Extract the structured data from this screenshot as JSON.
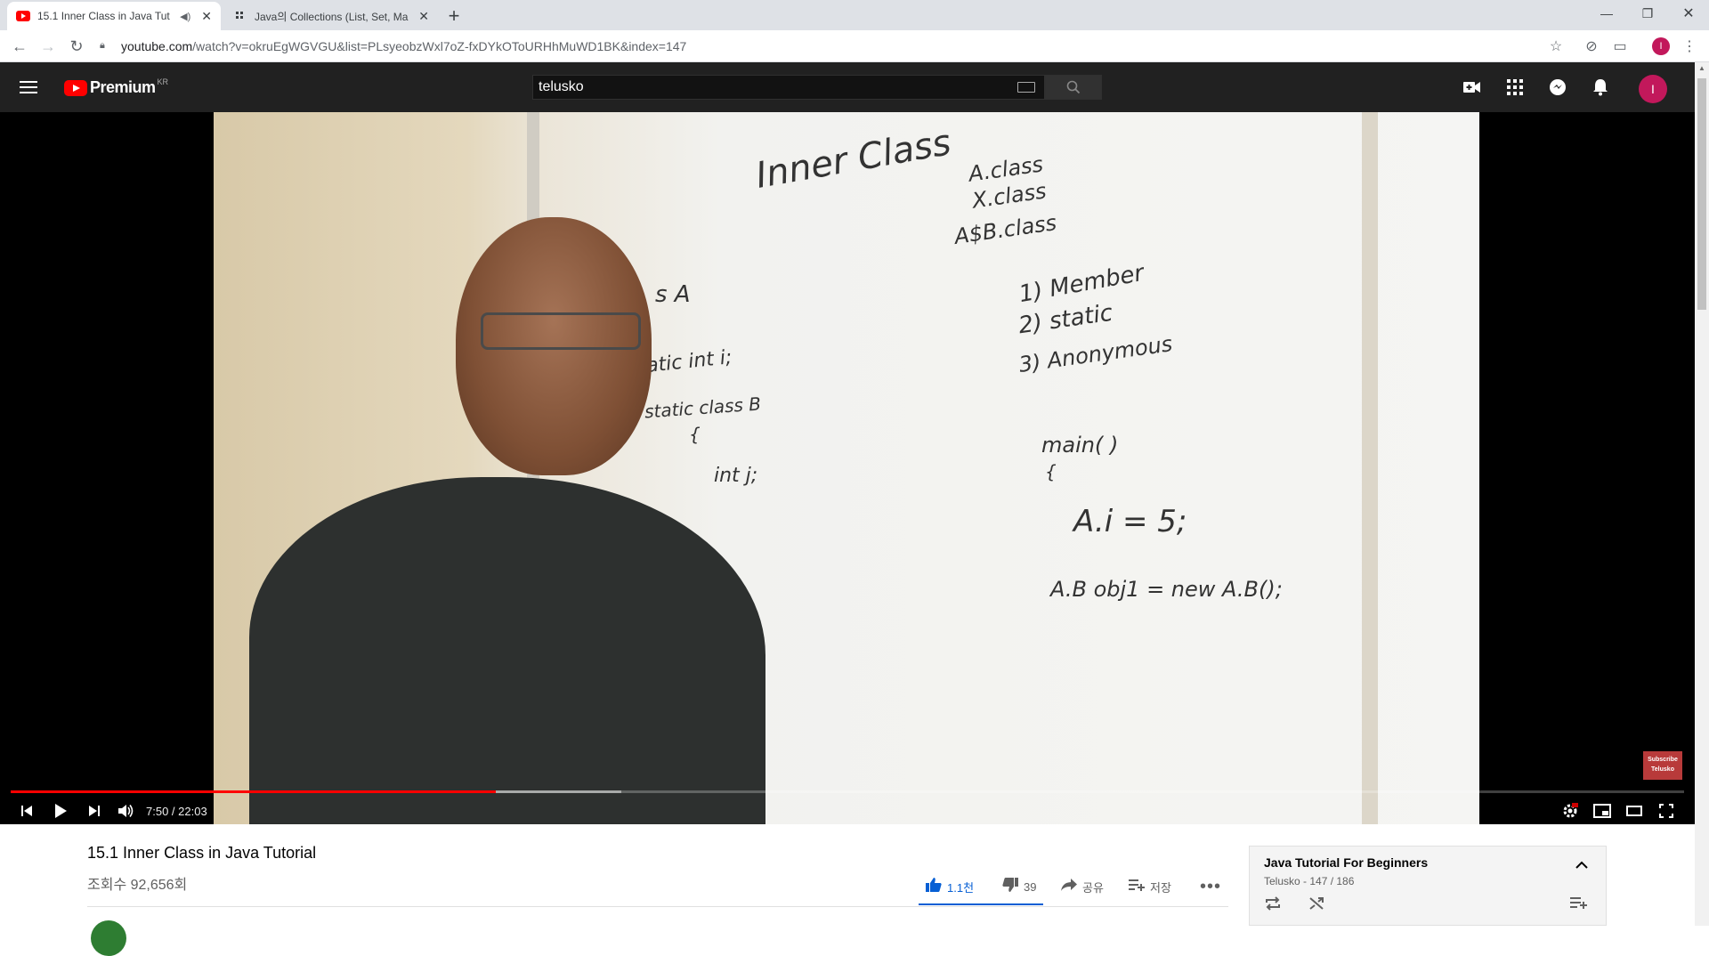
{
  "browser": {
    "tabs": [
      {
        "title": "15.1 Inner Class in Java Tut",
        "favicon": "youtube-icon",
        "active": true
      },
      {
        "title": "Java의 Collections (List, Set, Ma",
        "favicon": "velog-icon",
        "active": false
      }
    ],
    "url_host": "youtube.com",
    "url_rest": "/watch?v=okruEgWGVGU&list=PLsyeobzWxl7oZ-fxDYkOToURHhMuWD1BK&index=147",
    "profile_initial": "I"
  },
  "masthead": {
    "logo_text": "Premium",
    "region": "KR",
    "search_value": "telusko",
    "avatar_initial": "I"
  },
  "whiteboard": {
    "title": "Inner Class",
    "line1": "A.class",
    "line2": "X.class",
    "line3": "A$B.class",
    "list1": "1) Member",
    "list2": "2) static",
    "list3": "3) Anonymous",
    "code1": "s  A",
    "code2": "atic int  i;",
    "code3": "static class  B",
    "code4": "{",
    "code5": "int  j;",
    "code6": "main(   )",
    "code7": "{",
    "code8": "A.i = 5;",
    "code9": "A.B  obj1 = new  A.B();"
  },
  "player": {
    "time_label": "7:50 / 22:03",
    "played_fraction": 0.29,
    "buffered_fraction": 0.365,
    "subscribe_label_1": "Subscribe",
    "subscribe_label_2": "Telusko"
  },
  "video": {
    "title": "15.1 Inner Class in Java Tutorial",
    "views": "조회수 92,656회",
    "likes": "1.1천",
    "dislikes": "39",
    "share": "공유",
    "save": "저장"
  },
  "playlist": {
    "title": "Java Tutorial For Beginners",
    "subtitle": "Telusko - 147 / 186"
  },
  "colors": {
    "accent_red": "#ff0000",
    "like_blue": "#065fd4",
    "masthead_bg": "#212121"
  }
}
